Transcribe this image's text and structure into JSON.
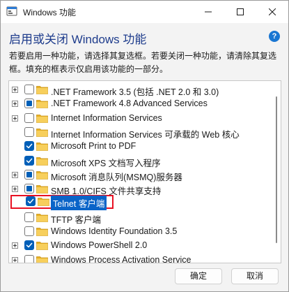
{
  "window": {
    "title": "Windows 功能"
  },
  "header": {
    "heading": "启用或关闭 Windows 功能",
    "help_glyph": "?",
    "description": "若要启用一种功能，请选择其复选框。若要关闭一种功能，请清除其复选框。填充的框表示仅启用该功能的一部分。"
  },
  "features": [
    {
      "label": ".NET Framework 3.5 (包括 .NET 2.0 和 3.0)",
      "expandable": true,
      "state": "unchecked",
      "selected": false
    },
    {
      "label": ".NET Framework 4.8 Advanced Services",
      "expandable": true,
      "state": "partial",
      "selected": false
    },
    {
      "label": "Internet Information Services",
      "expandable": true,
      "state": "unchecked",
      "selected": false
    },
    {
      "label": "Internet Information Services 可承载的 Web 核心",
      "expandable": false,
      "state": "unchecked",
      "selected": false
    },
    {
      "label": "Microsoft Print to PDF",
      "expandable": false,
      "state": "checked",
      "selected": false
    },
    {
      "label": "Microsoft XPS 文档写入程序",
      "expandable": false,
      "state": "checked",
      "selected": false
    },
    {
      "label": "Microsoft 消息队列(MSMQ)服务器",
      "expandable": true,
      "state": "partial",
      "selected": false
    },
    {
      "label": "SMB 1.0/CIFS 文件共享支持",
      "expandable": true,
      "state": "partial",
      "selected": false
    },
    {
      "label": "Telnet 客户端",
      "expandable": false,
      "state": "checked",
      "selected": true
    },
    {
      "label": "TFTP 客户端",
      "expandable": false,
      "state": "unchecked",
      "selected": false
    },
    {
      "label": "Windows Identity Foundation 3.5",
      "expandable": false,
      "state": "unchecked",
      "selected": false
    },
    {
      "label": "Windows PowerShell 2.0",
      "expandable": true,
      "state": "checked",
      "selected": false
    },
    {
      "label": "Windows Process Activation Service",
      "expandable": true,
      "state": "unchecked",
      "selected": false
    }
  ],
  "footer": {
    "ok_label": "确定",
    "cancel_label": "取消"
  },
  "colors": {
    "accent": "#005fb8",
    "heading": "#1e3c8c",
    "selection": "#0a64c8",
    "focus_outline": "#e81123",
    "folder": "#f4c542"
  },
  "icons": {
    "app": "windows-features-icon",
    "minimize": "minimize-icon",
    "maximize": "maximize-icon",
    "close": "close-icon",
    "help": "help-icon",
    "folder": "folder-icon",
    "expander": "expand-plus-icon",
    "checkmark": "checkmark-icon"
  }
}
